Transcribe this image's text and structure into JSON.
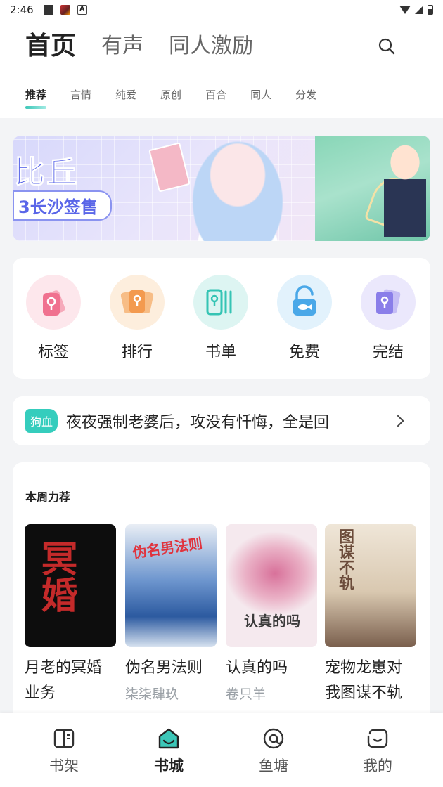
{
  "status_bar": {
    "time": "2:46",
    "icons": [
      "square-notification-icon",
      "app-notification-icon",
      "a-notification-icon",
      "wifi-icon",
      "signal-icon",
      "battery-icon"
    ],
    "a_glyph": "A"
  },
  "header": {
    "main_tabs": [
      {
        "label": "首页",
        "active": true
      },
      {
        "label": "有声",
        "active": false
      },
      {
        "label": "同人激励",
        "active": false
      }
    ],
    "search_icon": "search-icon",
    "sub_tabs": [
      {
        "label": "推荐",
        "active": true
      },
      {
        "label": "言情",
        "active": false
      },
      {
        "label": "纯爱",
        "active": false
      },
      {
        "label": "原创",
        "active": false
      },
      {
        "label": "百合",
        "active": false
      },
      {
        "label": "同人",
        "active": false
      },
      {
        "label": "分发",
        "active": false
      }
    ],
    "accent_color": "#3cc7b8"
  },
  "banner": {
    "title": "比丘",
    "subtitle": "3长沙签售"
  },
  "quick_entries": [
    {
      "label": "标签",
      "icon": "tag-icon",
      "bg": "#fde7ec",
      "color": "#f0718f"
    },
    {
      "label": "排行",
      "icon": "ranking-cards-icon",
      "bg": "#fdeedd",
      "color": "#f39a4f"
    },
    {
      "label": "书单",
      "icon": "booklist-icon",
      "bg": "#ddf5f2",
      "color": "#35c4b4"
    },
    {
      "label": "免费",
      "icon": "unlock-icon",
      "bg": "#e2f2fc",
      "color": "#4aa8e8"
    },
    {
      "label": "完结",
      "icon": "finished-cards-icon",
      "bg": "#ebe8fc",
      "color": "#8a7ee9"
    }
  ],
  "promo": {
    "badge": "狗血",
    "text": "夜夜强制老婆后，攻没有忏悔，全是回",
    "badge_color": "#35cdbd"
  },
  "weekly": {
    "title": "本周力荐",
    "books": [
      {
        "name_line1": "月老的冥婚",
        "name_line2": "业务",
        "author": "",
        "cover_text": "冥婚",
        "cover_bg": "#0d0d0d",
        "cover_fg": "#c42a2a"
      },
      {
        "name_line1": "伪名男法则",
        "name_line2": "",
        "author": "柒柒肆玖",
        "cover_text": "伪名男法则",
        "cover_bg": "#3d6fb4",
        "cover_fg": "#e0333d"
      },
      {
        "name_line1": "认真的吗",
        "name_line2": "",
        "author": "卷只羊",
        "cover_text": "认真的吗",
        "cover_bg": "#f1d9e2",
        "cover_fg": "#3a3a3a"
      },
      {
        "name_line1": "宠物龙崽对",
        "name_line2": "我图谋不轨",
        "author": "",
        "cover_text": "图谋不轨",
        "cover_bg": "#e7ddcf",
        "cover_fg": "#6b4b3a"
      }
    ]
  },
  "bottom_nav": [
    {
      "label": "书架",
      "icon": "bookshelf-icon",
      "active": false
    },
    {
      "label": "书城",
      "icon": "bookstore-icon",
      "active": true
    },
    {
      "label": "鱼塘",
      "icon": "fishpond-icon",
      "active": false
    },
    {
      "label": "我的",
      "icon": "profile-icon",
      "active": false
    }
  ]
}
